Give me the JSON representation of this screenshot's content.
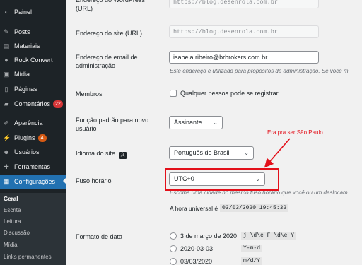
{
  "sidebar": {
    "items": [
      {
        "label": "Painel",
        "icon": "dashboard-icon"
      },
      {
        "label": "Posts",
        "icon": "pin-icon"
      },
      {
        "label": "Materiais",
        "icon": "folder-icon"
      },
      {
        "label": "Rock Convert",
        "icon": "rock-icon"
      },
      {
        "label": "Mídia",
        "icon": "media-icon"
      },
      {
        "label": "Páginas",
        "icon": "page-icon"
      },
      {
        "label": "Comentários",
        "icon": "comment-icon",
        "badge": "22"
      },
      {
        "label": "Aparência",
        "icon": "brush-icon"
      },
      {
        "label": "Plugins",
        "icon": "plugin-icon",
        "badge": "4"
      },
      {
        "label": "Usuários",
        "icon": "users-icon"
      },
      {
        "label": "Ferramentas",
        "icon": "tools-icon"
      },
      {
        "label": "Configurações",
        "icon": "settings-icon"
      }
    ],
    "submenu": [
      "Geral",
      "Escrita",
      "Leitura",
      "Discussão",
      "Mídia",
      "Links permanentes"
    ]
  },
  "form": {
    "wp_address_label": "Endereço do WordPress (URL)",
    "wp_address_value": "https://blog.desenrola.com.br",
    "site_address_label": "Endereço do site (URL)",
    "site_address_value": "https://blog.desenrola.com.br",
    "admin_email_label": "Endereço de email de administração",
    "admin_email_value": "isabela.ribeiro@brbrokers.com.br",
    "admin_email_desc": "Este endereço é utilizado para propósitos de administração. Se você m",
    "membership_label": "Membros",
    "membership_checkbox": "Qualquer pessoa pode se registrar",
    "default_role_label": "Função padrão para novo usuário",
    "default_role_value": "Assinante",
    "language_label": "Idioma do site",
    "language_value": "Português do Brasil",
    "timezone_label": "Fuso horário",
    "timezone_value": "UTC+0",
    "timezone_desc": "Escolha uma cidade no mesmo fuso horário que você ou um deslocam",
    "universal_time_label": "A hora universal é",
    "universal_time_value": "03/03/2020 19:45:32",
    "date_format_label": "Formato de data",
    "date_formats": [
      {
        "label": "3 de março de 2020",
        "code": "j \\d\\e F \\d\\e Y"
      },
      {
        "label": "2020-03-03",
        "code": "Y-m-d"
      },
      {
        "label": "03/03/2020",
        "code": "m/d/Y"
      }
    ]
  },
  "annotation": {
    "text": "Era pra ser São Paulo",
    "color": "#e3101a"
  },
  "colors": {
    "sidebar_bg": "#1d2327",
    "active_bg": "#2271b1",
    "badge_bg": "#d63638"
  }
}
